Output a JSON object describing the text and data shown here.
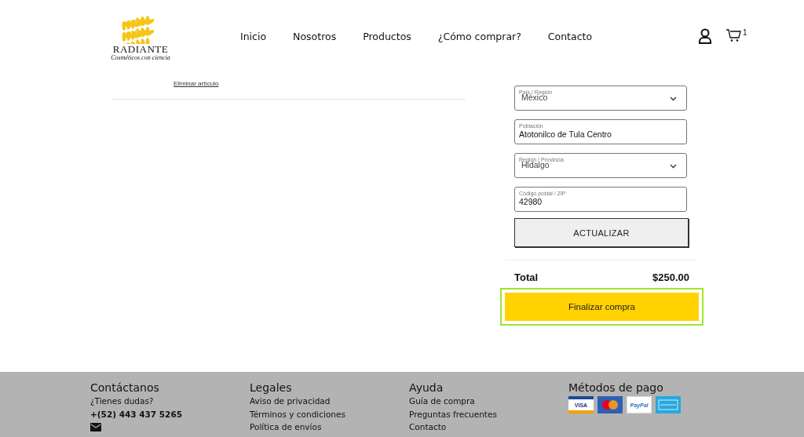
{
  "header": {
    "logo": {
      "name": "RADIANTE",
      "tagline": "Cosméticos con ciencia"
    },
    "nav": [
      {
        "label": "Inicio"
      },
      {
        "label": "Nosotros"
      },
      {
        "label": "Productos"
      },
      {
        "label": "¿Cómo comprar?"
      },
      {
        "label": "Contacto"
      }
    ],
    "cart_count": "1"
  },
  "cart": {
    "remove_link": "Eliminar artículo"
  },
  "shipping_form": {
    "fields": [
      {
        "kind": "select",
        "label": "País / Región",
        "value": "México"
      },
      {
        "kind": "text",
        "label": "Población",
        "value": "Atotonilco de Tula Centro"
      },
      {
        "kind": "select",
        "label": "Región / Provincia",
        "value": "Hidalgo"
      },
      {
        "kind": "text",
        "label": "Código postal / ZIP",
        "value": "42980"
      }
    ],
    "update_button": "ACTUALIZAR"
  },
  "total": {
    "label": "Total",
    "amount": "$250.00"
  },
  "checkout_button": {
    "label": "Finalizar compra",
    "focused": true
  },
  "footer": {
    "columns": [
      {
        "title": "Contáctanos",
        "items": [
          {
            "kind": "text",
            "text": "¿Tienes dudas?"
          },
          {
            "kind": "phone",
            "text": "+(52) 443 437 5265"
          },
          {
            "kind": "mail"
          }
        ]
      },
      {
        "title": "Legales",
        "items": [
          {
            "kind": "link",
            "text": "Aviso de privacidad"
          },
          {
            "kind": "link",
            "text": "Términos y condiciones"
          },
          {
            "kind": "link",
            "text": "Política de envíos"
          }
        ]
      },
      {
        "title": "Ayuda",
        "items": [
          {
            "kind": "link",
            "text": "Guía de compra"
          },
          {
            "kind": "link",
            "text": "Preguntas frecuentes"
          },
          {
            "kind": "link",
            "text": "Contacto"
          }
        ]
      },
      {
        "title": "Métodos de pago",
        "payments": [
          {
            "kind": "visa",
            "label": "VISA"
          },
          {
            "kind": "mastercard"
          },
          {
            "kind": "paypal",
            "label": "PayPal"
          },
          {
            "kind": "amex"
          }
        ]
      }
    ]
  }
}
